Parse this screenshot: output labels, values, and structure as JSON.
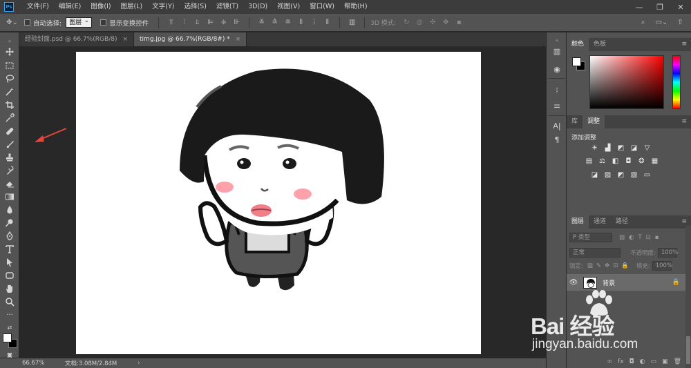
{
  "app": {
    "logo_text": "Ps"
  },
  "menu": [
    "文件(F)",
    "编辑(E)",
    "图像(I)",
    "图层(L)",
    "文字(Y)",
    "选择(S)",
    "滤镜(T)",
    "3D(D)",
    "视图(V)",
    "窗口(W)",
    "帮助(H)"
  ],
  "window_controls": {
    "minimize": "—",
    "restore": "❐",
    "close": "✕"
  },
  "options_bar": {
    "auto_select_label": "自动选择:",
    "auto_select_value": "图层",
    "show_transform_label": "显示变换控件",
    "mode_3d_label": "3D 模式:"
  },
  "tabs": [
    {
      "label": "经验封面.psd @ 66.7%(RGB/8)",
      "close": "×",
      "active": false
    },
    {
      "label": "timg.jpg @ 66.7%(RGB/8#) *",
      "close": "×",
      "active": true
    }
  ],
  "status": {
    "zoom": "66.67%",
    "doc_size": "文档:3.08M/2.84M",
    "arrow": "›"
  },
  "panels": {
    "color_tabs": [
      "颜色",
      "色板"
    ],
    "adjust_tabs": [
      "库",
      "调整"
    ],
    "adjust_title": "添加调整",
    "layer_tabs": [
      "图层",
      "通道",
      "路径"
    ],
    "layer_kind": "Ρ 类型",
    "blend_mode": "正常",
    "opacity_label": "不透明度:",
    "opacity_value": "100%",
    "lock_label": "锁定:",
    "fill_label": "填充:",
    "fill_value": "100%",
    "menu_glyph": "≡"
  },
  "layers": [
    {
      "name": "背景",
      "visible_glyph": "👁",
      "lock_glyph": "🔒"
    }
  ],
  "layers_footer": [
    "∞",
    "fx",
    "◘",
    "◐",
    "▭",
    "▣",
    "🗑"
  ],
  "watermark": {
    "brand": "Bai 经验",
    "url": "jingyan.baidu.com"
  },
  "colors": {
    "foreground": "#ffffff",
    "background": "#000000",
    "accent": "#31a8ff",
    "arrow": "#e8453c"
  }
}
